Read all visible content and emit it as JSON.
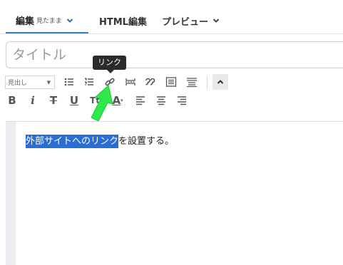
{
  "tabs": {
    "edit_label": "編集",
    "edit_sub": "見たまま",
    "html_label": "HTML編集",
    "preview_label": "プレビュー"
  },
  "title_field": {
    "placeholder": "タイトル"
  },
  "tooltip": {
    "text": "リンク"
  },
  "toolbar": {
    "format_select": "見出し",
    "bold_label": "B",
    "italic_label": "i",
    "strike_label": "T",
    "underline_label": "U",
    "textsize_label": "Tt",
    "fontcolor_label": "A"
  },
  "editor": {
    "selected_text": "外部サイトへのリンク",
    "rest_text": "を設置する。"
  },
  "colors": {
    "accent": "#2f80c9",
    "selection": "#2a6dd3",
    "annotation_arrow": "#2fe84a"
  }
}
